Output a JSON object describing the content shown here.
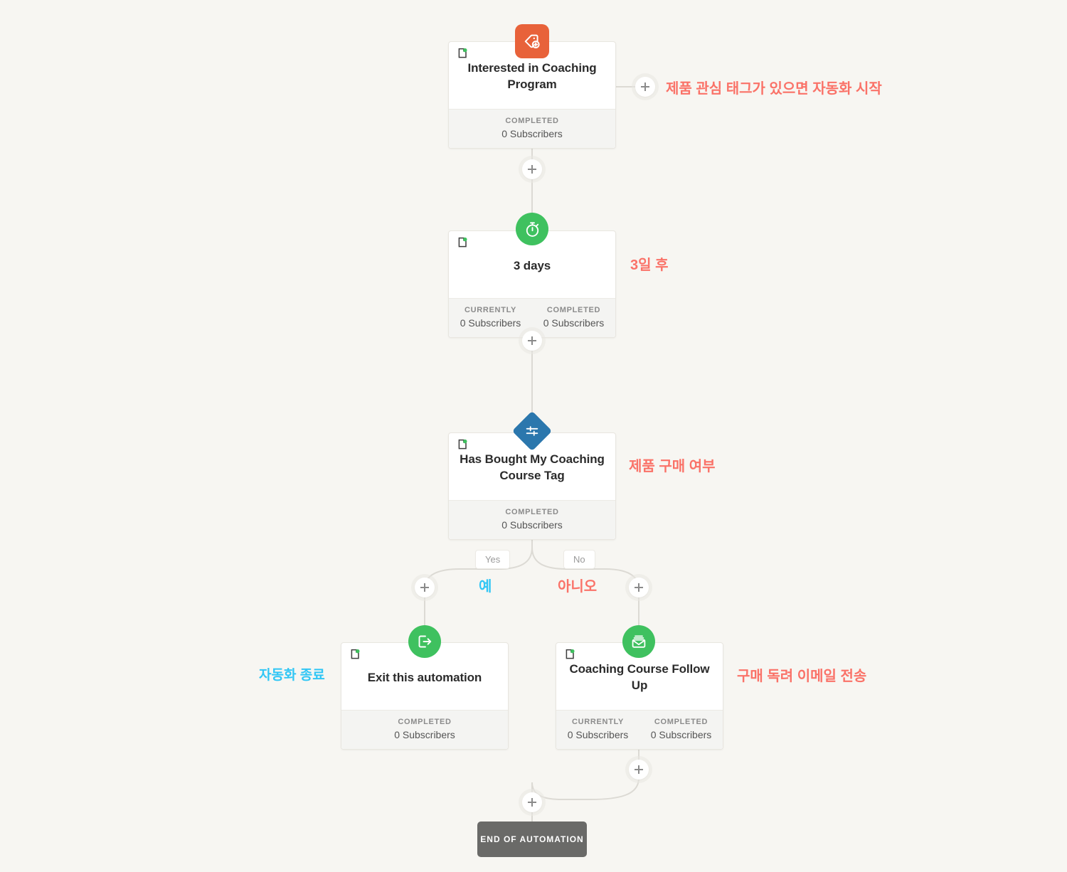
{
  "theme": {
    "background": "#f7f6f2",
    "card_bg": "#ffffff",
    "footer_bg": "#f4f4f2",
    "wire": "#dcdad4",
    "trigger_orange": "#e8623a",
    "action_green": "#3fc15f",
    "condition_blue": "#2b77ad",
    "end_gray": "#6a6a68",
    "annot_coral": "#fa7268",
    "annot_cyan": "#31c6f5"
  },
  "nodes": {
    "trigger": {
      "title": "Interested in Coaching Program",
      "icon": "tag-plus-icon",
      "stats": [
        {
          "label": "COMPLETED",
          "value": "0 Subscribers"
        }
      ]
    },
    "delay": {
      "title": "3 days",
      "icon": "stopwatch-icon",
      "stats": [
        {
          "label": "CURRENTLY",
          "value": "0 Subscribers"
        },
        {
          "label": "COMPLETED",
          "value": "0 Subscribers"
        }
      ]
    },
    "condition": {
      "title": "Has Bought My Coaching Course Tag",
      "icon": "condition-sliders-icon",
      "stats": [
        {
          "label": "COMPLETED",
          "value": "0 Subscribers"
        }
      ]
    },
    "exit": {
      "title": "Exit this automation",
      "icon": "exit-arrow-icon",
      "stats": [
        {
          "label": "COMPLETED",
          "value": "0 Subscribers"
        }
      ]
    },
    "email": {
      "title": "Coaching Course Follow Up",
      "icon": "envelope-send-icon",
      "stats": [
        {
          "label": "CURRENTLY",
          "value": "0 Subscribers"
        },
        {
          "label": "COMPLETED",
          "value": "0 Subscribers"
        }
      ]
    }
  },
  "branches": {
    "yes_label": "Yes",
    "no_label": "No"
  },
  "end": {
    "label": "END OF AUTOMATION"
  },
  "annotations": {
    "trigger": "제품 관심 태그가 있으면 자동화 시작",
    "delay": "3일 후",
    "condition": "제품 구매 여부",
    "yes": "예",
    "no": "아니오",
    "exit": "자동화 종료",
    "email": "구매 독려 이메일 전송"
  }
}
